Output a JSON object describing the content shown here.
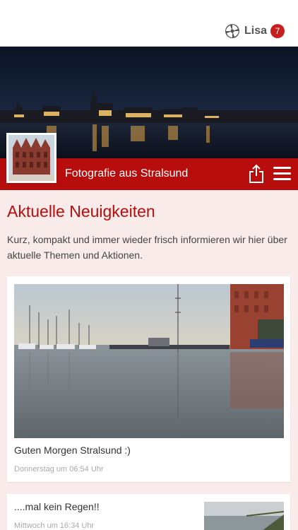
{
  "header": {
    "user_name": "Lisa",
    "notification_count": "7",
    "logo_icon": "pinwheel-logo-icon"
  },
  "site": {
    "title": "Fotografie aus Stralsund",
    "share_icon": "share-icon",
    "menu_icon": "hamburger-menu-icon"
  },
  "news": {
    "heading": "Aktuelle Neuigkeiten",
    "intro": "Kurz, kompakt und immer wieder frisch informieren wir hier über aktuelle Themen und Aktionen.",
    "posts": [
      {
        "caption": "Guten Morgen Stralsund :)",
        "meta": "Donnerstag um 06:54 Uhr"
      },
      {
        "caption": "....mal kein Regen!!",
        "meta": "Mittwoch um 16:34 Uhr"
      }
    ]
  },
  "colors": {
    "brand_red": "#b80d0d",
    "page_bg": "#f8ebea",
    "badge_red": "#c81e1e"
  }
}
